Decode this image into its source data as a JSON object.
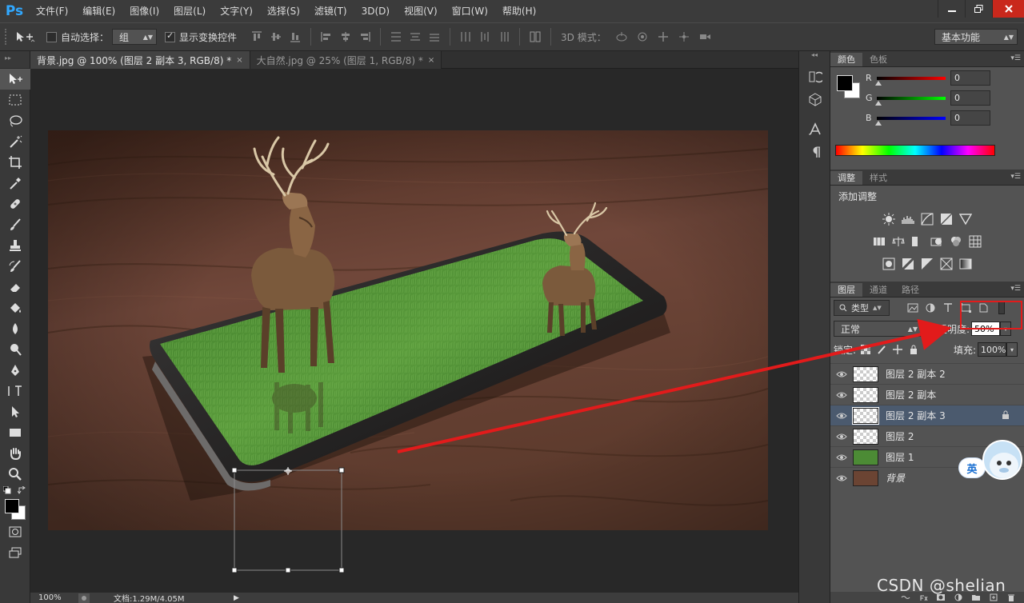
{
  "app": {
    "logo": "Ps"
  },
  "menu": [
    "文件(F)",
    "编辑(E)",
    "图像(I)",
    "图层(L)",
    "文字(Y)",
    "选择(S)",
    "滤镜(T)",
    "3D(D)",
    "视图(V)",
    "窗口(W)",
    "帮助(H)"
  ],
  "options": {
    "auto_select_label": "自动选择：",
    "auto_select_value": "组",
    "show_transform_label": "显示变换控件",
    "mode_3d_label": "3D 模式：",
    "workspace": "基本功能"
  },
  "tabs": [
    {
      "label": "背景.jpg @ 100% (图层 2 副本 3, RGB/8) *",
      "close": "×"
    },
    {
      "label": "大自然.jpg @ 25% (图层 1, RGB/8) *",
      "close": "×"
    }
  ],
  "status": {
    "zoom": "100%",
    "doc": "文档:1.29M/4.05M"
  },
  "color_panel": {
    "tabs": [
      "颜色",
      "色板"
    ],
    "r_label": "R",
    "g_label": "G",
    "b_label": "B",
    "r": "0",
    "g": "0",
    "b": "0"
  },
  "adjust_panel": {
    "tabs": [
      "调整",
      "样式"
    ],
    "title": "添加调整"
  },
  "layers_panel": {
    "tabs": [
      "图层",
      "通道",
      "路径"
    ],
    "filter": "类型",
    "blend_mode": "正常",
    "opacity_label": "不透明度:",
    "opacity": "50%",
    "lock_label": "锁定:",
    "fill_label": "填充:",
    "fill": "100%",
    "layers": [
      {
        "name": "图层 2 副本 2",
        "thumb": "transparent"
      },
      {
        "name": "图层 2 副本",
        "thumb": "transparent"
      },
      {
        "name": "图层 2 副本 3",
        "thumb": "transparent",
        "selected": true
      },
      {
        "name": "图层 2",
        "thumb": "transparent"
      },
      {
        "name": "图层 1",
        "thumb": "grass"
      },
      {
        "name": "背景",
        "thumb": "wood"
      }
    ]
  },
  "overlay": {
    "ime": "英",
    "watermark": "CSDN @shelian"
  },
  "colors": {
    "annotation_red": "#e21b1b",
    "ps_blue": "#31a8ff",
    "selected_layer": "#4b5a6e"
  }
}
